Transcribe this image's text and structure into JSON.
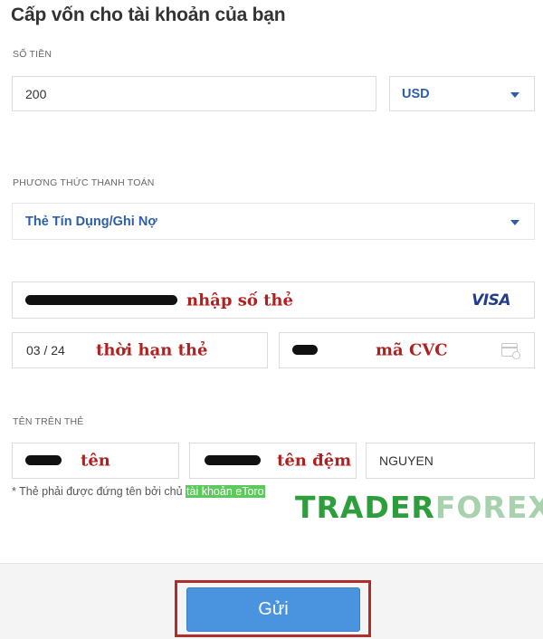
{
  "title": "Cấp vốn cho tài khoản của bạn",
  "amount": {
    "label": "SỐ TIỀN",
    "value": "200",
    "currency": "USD"
  },
  "payment_method": {
    "label": "PHƯƠNG THỨC THANH TOÁN",
    "value": "Thẻ Tín Dụng/Ghi Nợ"
  },
  "card": {
    "number_annotation": "nhập số thẻ",
    "brand": "VISA",
    "expiry": "03 / 24",
    "expiry_annotation": "thời hạn thẻ",
    "cvc_annotation": "mã CVC"
  },
  "name_on_card": {
    "label": "TÊN TRÊN THẺ",
    "first_annotation": "tên",
    "middle_annotation": "tên đệm",
    "last_value": "NGUYEN"
  },
  "footnote": {
    "text": "* Thẻ phải được đứng tên bởi chủ ",
    "highlight": "tài khoản eToro"
  },
  "watermark": {
    "part1": "TRADER",
    "part2": "FOREX"
  },
  "submit_label": "Gửi",
  "colors": {
    "accent_blue": "#2c5fa8",
    "button_blue": "#4a94df",
    "annotation_red": "#b21f1f",
    "highlight_green": "#5cc95c",
    "frame_red": "#b12d2d"
  }
}
